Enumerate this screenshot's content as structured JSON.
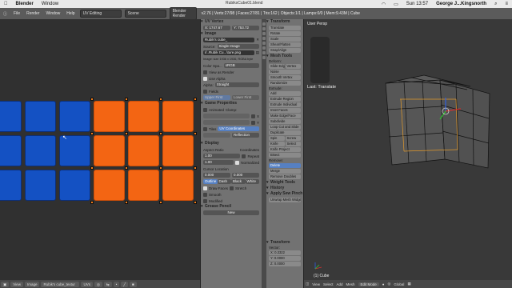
{
  "macbar": {
    "apple": "",
    "app": "Blender",
    "menu": "Window",
    "clock": "Sun 13:57",
    "user": "George J...Kingsnorth",
    "wifi": "",
    "battery": ""
  },
  "window_title": "RubiksCube01.blend",
  "header": {
    "menus": [
      "File",
      "Render",
      "Window",
      "Help"
    ],
    "layout": "UV Editing",
    "scene": "Scene",
    "engine": "Blender Render",
    "stats": "v2.76 | Verts:27/98 | Faces:27/81 | Tris:162 | Objects:1/1 | Lamps:0/0 | Mem:9.43M | Cube"
  },
  "uv_footer": {
    "view": "View",
    "image": "Image",
    "image_name": "Rubik's cube_textur",
    "uvs": "UVs"
  },
  "properties": {
    "uv_vertex": "UV Vertex",
    "x_label": "X:",
    "x_val": "1747.67",
    "y_label": "Y:",
    "y_val": "753.72",
    "image": "Image",
    "image_name": "Rubik's cube_",
    "source": "Source:",
    "source_val": "Single Image",
    "filepath": "//..Rubik Cu...\\ture.png",
    "info": "Image: size 1936 x 1936, RGBA byte",
    "color_space": "Color Spa...",
    "color_space_val": "sRGB",
    "view_as_render": "View as Render",
    "use_alpha": "Use Alpha",
    "alpha": "Alpha:",
    "alpha_val": "Straight",
    "fields": "Fields",
    "upper_first": "Upper First",
    "lower_first": "Lower First",
    "game_properties": "Game Properties",
    "animated": "Animated",
    "clamp": "Clamp:",
    "clamp_x": "X",
    "clamp_y": "Y",
    "tiles": "Tiles",
    "uv_coordinates": "UV Coordinates",
    "reflection": "Reflection",
    "display": "Display",
    "aspect_ratio": "Aspect Ratio",
    "coordinates": "Coordinates",
    "aspect_x": "1.00",
    "aspect_y": "1.00",
    "repeat": "Repeat",
    "normalized": "Normalized",
    "cursor_location": "Cursor Location",
    "cursor_x": "0.000",
    "cursor_y": "0.000",
    "outline": "Outline",
    "dash": "Dash",
    "black": "Black",
    "white": "White",
    "draw_faces": "Draw Faces",
    "stretch": "Stretch",
    "smooth": "Smooth",
    "modified": "Modified",
    "grease_pencil": "Grease Pencil",
    "new": "New"
  },
  "tools": {
    "transform": "Transform",
    "translate": "Translate",
    "rotate": "Rotate",
    "scale": "Scale",
    "shear": "Shear/Flatten",
    "snap": "Snap/Align",
    "mesh_tools": "Mesh Tools",
    "deform": "Deform:",
    "slide_edge": "Slide Edge",
    "vertex": "Vertex",
    "noise": "Noise",
    "smooth_vertex": "Smooth Vertex",
    "randomize": "Randomize",
    "extrude": "Extrude:",
    "add": "Add",
    "extrude_region": "Extrude Region",
    "extrude_individual": "Extrude Individual",
    "inset_faces": "Inset Faces",
    "make_edge_face": "Make Edge/Face",
    "subdivide": "Subdivide",
    "loop_cut": "Loop Cut and Slide",
    "duplicate": "Duplicate",
    "spin": "Spin",
    "screw": "Screw",
    "knife": "Knife",
    "select": "Select",
    "knife_project": "Knife Project",
    "bisect": "Bisect",
    "remove": "Remove:",
    "delete": "Delete",
    "merge": "Merge",
    "remove_doubles": "Remove Doubles",
    "weight_tools": "Weight Tools",
    "history": "History",
    "apply_sew": "Apply Sew Pinch",
    "unwrap": "Unwrap Mesh Widget",
    "transform_panel": "Transform",
    "vector": "Vector:",
    "vx": "0.3322",
    "vy": "0.0000",
    "vz": "0.0000"
  },
  "viewport": {
    "view_label": "User Persp",
    "last_op": "Last: Translate",
    "object_label": "(1) Cube",
    "footer_view": "View",
    "footer_select": "Select",
    "footer_add": "Add",
    "footer_mesh": "Mesh",
    "footer_mode": "Edit Mode",
    "footer_global": "Global"
  },
  "uv_grid": {
    "blue_color": "#1451c3",
    "orange_color": "#f36513"
  }
}
